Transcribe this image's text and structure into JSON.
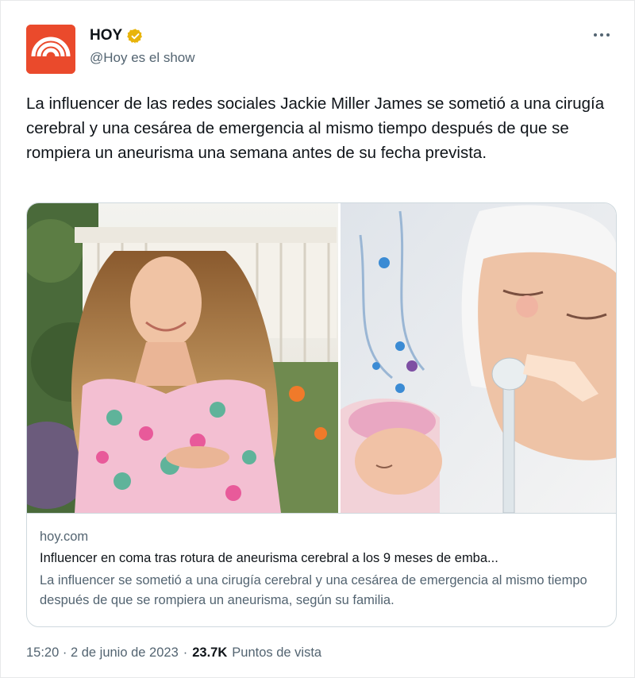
{
  "account": {
    "name": "HOY",
    "handle": "@Hoy es el show",
    "verified": true,
    "avatar_icon": "hoy-rainbow-logo",
    "avatar_color": "#ea4a2c",
    "verified_color": "#e8b40a"
  },
  "tweet": {
    "text": "La influencer de las redes sociales Jackie Miller James se sometió a una cirugía cerebral y una cesárea de emergencia al mismo tiempo después de que se rompiera un aneurisma una semana antes de su fecha prevista."
  },
  "card": {
    "domain": "hoy.com",
    "title": "Influencer en coma tras rotura de aneurisma cerebral a los 9 meses de emba...",
    "description": "La influencer se sometió a una cirugía cerebral y una cesárea de emergencia al mismo tiempo después de que se rompiera un aneurisma, según su familia."
  },
  "footer": {
    "time": "15:20 · 2 de junio de 2023",
    "separator": "·",
    "views_count": "23.7K",
    "views_label": "Puntos de vista"
  }
}
